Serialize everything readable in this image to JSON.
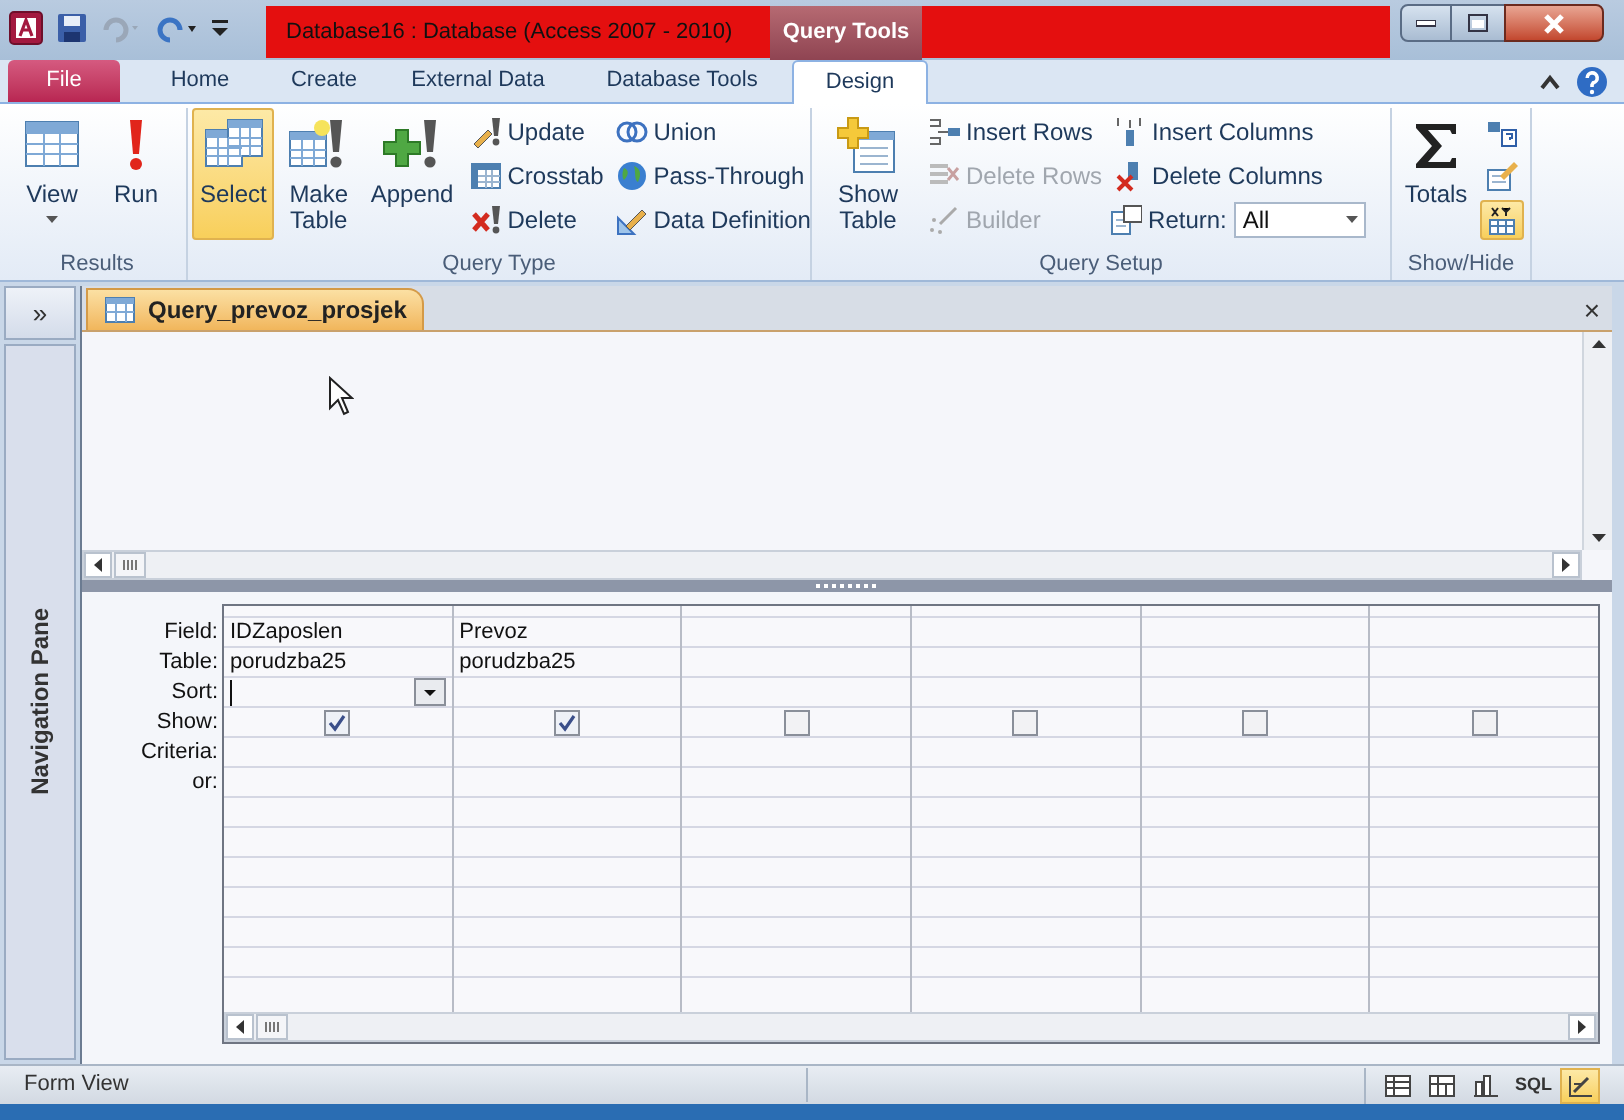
{
  "window": {
    "title": "Database16 : Database (Access 2007 - 2010)",
    "contextual_tab": "Query Tools"
  },
  "tabs": [
    {
      "label": "File",
      "kind": "file",
      "selected": false
    },
    {
      "label": "Home",
      "kind": "tab",
      "selected": false
    },
    {
      "label": "Create",
      "kind": "tab",
      "selected": false
    },
    {
      "label": "External Data",
      "kind": "tab",
      "selected": false
    },
    {
      "label": "Database Tools",
      "kind": "tab",
      "selected": false
    },
    {
      "label": "Design",
      "kind": "tab",
      "selected": true
    }
  ],
  "ribbon": [
    {
      "label": "Results",
      "items": [
        {
          "kind": "large",
          "label": "View"
        },
        {
          "kind": "large",
          "label": "Run"
        }
      ]
    },
    {
      "label": "Query Type",
      "items": [
        {
          "kind": "large",
          "label": "Select",
          "selected": true
        },
        {
          "kind": "large",
          "label": "Make Table",
          "selected": false
        },
        {
          "kind": "large",
          "label": "Append",
          "selected": false
        },
        {
          "kind": "small",
          "label": "Update",
          "selected": false
        },
        {
          "kind": "small",
          "label": "Crosstab",
          "selected": false
        },
        {
          "kind": "small",
          "label": "Delete",
          "selected": false
        },
        {
          "kind": "small",
          "label": "Union",
          "selected": false
        },
        {
          "kind": "small",
          "label": "Pass-Through",
          "selected": false
        },
        {
          "kind": "small",
          "label": "Data Definition",
          "selected": false
        }
      ]
    },
    {
      "label": "Query Setup",
      "items": [
        {
          "kind": "large",
          "label": "Show Table"
        },
        {
          "kind": "small",
          "label": "Insert Rows",
          "disabled": false
        },
        {
          "kind": "small",
          "label": "Delete Rows",
          "disabled": true
        },
        {
          "kind": "small",
          "label": "Builder",
          "disabled": true
        },
        {
          "kind": "small",
          "label": "Insert Columns",
          "disabled": false
        },
        {
          "kind": "small",
          "label": "Delete Columns",
          "disabled": false
        },
        {
          "kind": "combo",
          "label": "Return:",
          "value": "All"
        }
      ]
    },
    {
      "label": "Show/Hide",
      "items": [
        {
          "kind": "large",
          "label": "Totals"
        },
        {
          "kind": "icon",
          "selected": false
        },
        {
          "kind": "icon",
          "selected": false
        },
        {
          "kind": "icon",
          "selected": true
        }
      ]
    }
  ],
  "navigation_pane": {
    "toggle": "»",
    "label": "Navigation Pane"
  },
  "document_tab": {
    "label": "Query_prevoz_prosjek",
    "close": "×"
  },
  "grid": {
    "row_labels": [
      "Field:",
      "Table:",
      "Sort:",
      "Show:",
      "Criteria:",
      "or:"
    ],
    "columns": [
      {
        "field": "IDZaposlen",
        "table": "porudzba25",
        "show": true,
        "sort_open": true
      },
      {
        "field": "Prevoz",
        "table": "porudzba25",
        "show": true,
        "sort_open": false
      },
      {
        "show": false,
        "sort_open": false
      },
      {
        "show": false,
        "sort_open": false
      },
      {
        "show": false,
        "sort_open": false
      },
      {
        "show": false,
        "sort_open": false
      }
    ]
  },
  "status_bar": {
    "text": "Form View",
    "views": [
      {
        "selected": false
      },
      {
        "selected": false
      },
      {
        "selected": false
      },
      {
        "label": "SQL",
        "selected": false
      },
      {
        "selected": true
      }
    ]
  }
}
